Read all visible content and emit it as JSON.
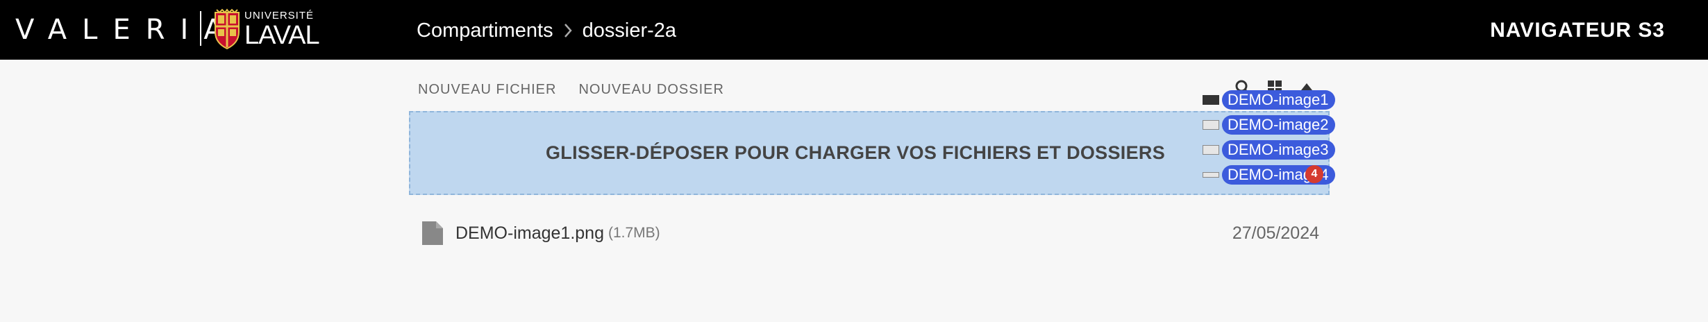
{
  "header": {
    "brand": "VALERIA",
    "university_small": "UNIVERSITÉ",
    "university_big": "LAVAL",
    "breadcrumb": [
      "Compartiments",
      "dossier-2a"
    ],
    "app_title": "NAVIGATEUR S3"
  },
  "toolbar": {
    "new_file": "NOUVEAU FICHIER",
    "new_folder": "NOUVEAU DOSSIER",
    "icons": [
      "search-icon",
      "grid-view-icon",
      "sort-up-icon"
    ]
  },
  "dropzone": {
    "text": "GLISSER-DÉPOSER POUR CHARGER VOS FICHIERS ET DOSSIERS"
  },
  "drag_preview": {
    "items": [
      "DEMO-image1",
      "DEMO-image2",
      "DEMO-image3",
      "DEMO-image4"
    ],
    "count": "4"
  },
  "files": [
    {
      "name": "DEMO-image1.png",
      "size": "(1.7MB)",
      "date": "27/05/2024"
    }
  ],
  "colors": {
    "header_bg": "#000000",
    "dropzone_bg": "#bfd7ef",
    "drag_label": "#3c5bdc",
    "badge": "#d53b2f"
  }
}
